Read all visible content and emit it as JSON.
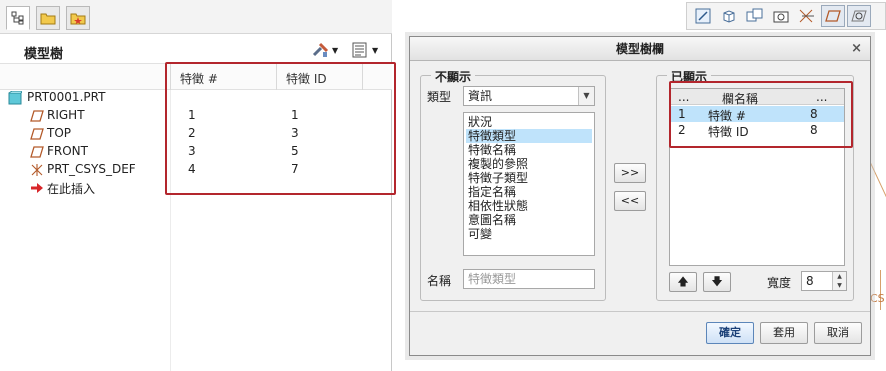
{
  "model_tree": {
    "title": "模型樹",
    "headers": {
      "feature_num": "特徵 #",
      "feature_id": "特徵 ID"
    },
    "items": [
      {
        "name": "PRT0001.PRT",
        "icon": "part-icon",
        "num": "",
        "id": ""
      },
      {
        "name": "RIGHT",
        "icon": "datum-plane-icon",
        "num": "1",
        "id": "1"
      },
      {
        "name": "TOP",
        "icon": "datum-plane-icon",
        "num": "2",
        "id": "3"
      },
      {
        "name": "FRONT",
        "icon": "datum-plane-icon",
        "num": "3",
        "id": "5"
      },
      {
        "name": "PRT_CSYS_DEF",
        "icon": "csys-icon",
        "num": "4",
        "id": "7"
      },
      {
        "name": "在此插入",
        "icon": "insert-arrow-icon",
        "num": "",
        "id": ""
      }
    ],
    "highlight_color": "#b3262d"
  },
  "graphics": {
    "csys_text": "CS"
  },
  "dialog": {
    "title": "模型樹欄",
    "not_displayed": {
      "group_label": "不顯示",
      "type_label": "類型",
      "type_value": "資訊",
      "options": [
        "狀況",
        "特徵類型",
        "特徵名稱",
        "複製的參照",
        "特徵子類型",
        "指定名稱",
        "相依性狀態",
        "意圖名稱",
        "可變"
      ],
      "selected_option": "特徵類型",
      "name_label": "名稱",
      "name_placeholder": "特徵類型"
    },
    "move_right_label": ">>",
    "move_left_label": "<<",
    "displayed": {
      "group_label": "已顯示",
      "headers": {
        "index": "...",
        "column_name": "欄名稱",
        "width": "..."
      },
      "rows": [
        {
          "index": "1",
          "name": "特徵 #",
          "width": "8"
        },
        {
          "index": "2",
          "name": "特徵 ID",
          "width": "8"
        }
      ],
      "width_label": "寬度",
      "width_value": "8"
    },
    "buttons": {
      "ok": "確定",
      "apply": "套用",
      "cancel": "取消"
    },
    "selection_color": "#bfe3fb"
  }
}
